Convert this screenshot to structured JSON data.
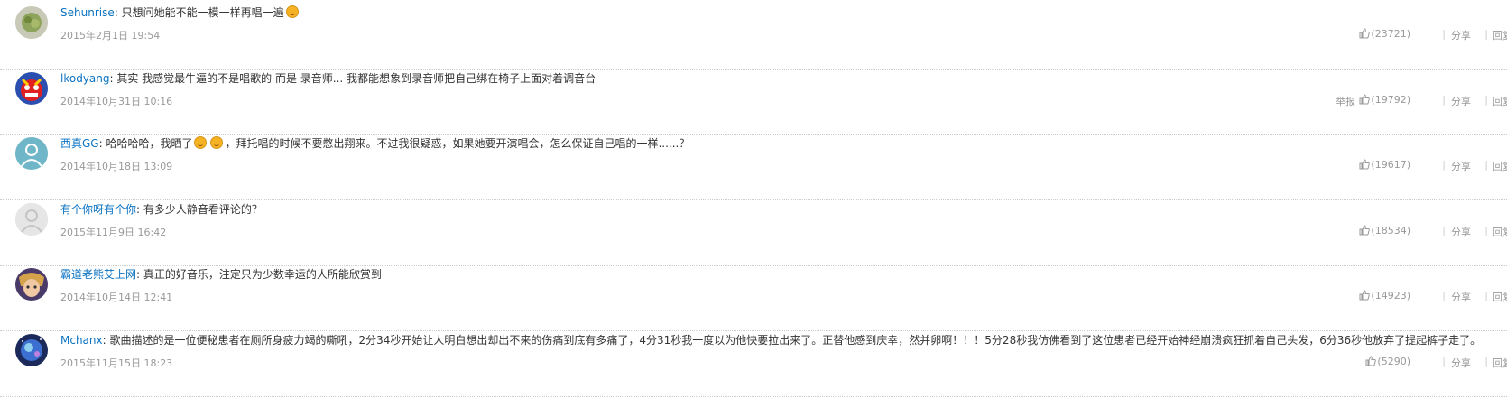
{
  "comments": [
    {
      "user": "Sehunrise",
      "segments": [
        "只想问她能不能一模一样再唱一遍"
      ],
      "emoji_after": [
        true
      ],
      "time": "2015年2月1日 19:54",
      "likes": "(23721)",
      "show_report": false,
      "avatar_icon": "plant-avatar-icon"
    },
    {
      "user": "lkodyang",
      "segments": [
        "其实 我感觉最牛逼的不是唱歌的 而是 录音师... 我都能想象到录音师把自己绑在椅子上面对着调音台"
      ],
      "emoji_after": [
        false
      ],
      "time": "2014年10月31日 10:16",
      "likes": "(19792)",
      "show_report": true,
      "avatar_icon": "red-character-avatar-icon"
    },
    {
      "user": "西真GG",
      "segments": [
        "哈哈哈哈，我晒了",
        "",
        "，拜托唱的时候不要憋出翔来。不过我很疑惑，如果她要开演唱会，怎么保证自己唱的一样......？"
      ],
      "emoji_after": [
        true,
        true,
        false
      ],
      "time": "2014年10月18日 13:09",
      "likes": "(19617)",
      "show_report": false,
      "avatar_icon": "default-teal-avatar-icon"
    },
    {
      "user": "有个你呀有个你",
      "segments": [
        "有多少人静音看评论的？"
      ],
      "emoji_after": [
        false
      ],
      "time": "2015年11月9日 16:42",
      "likes": "(18534)",
      "show_report": false,
      "avatar_icon": "default-gray-avatar-icon"
    },
    {
      "user": "霸道老熊艾上网",
      "segments": [
        "真正的好音乐，注定只为少数幸运的人所能欣赏到"
      ],
      "emoji_after": [
        false
      ],
      "time": "2014年10月14日 12:41",
      "likes": "(14923)",
      "show_report": false,
      "avatar_icon": "anime-character-avatar-icon"
    },
    {
      "user": "Mchanx",
      "segments": [
        "歌曲描述的是一位便秘患者在厕所身疲力竭的嘶吼，2分34秒开始让人明白想出却出不来的伤痛到底有多痛了，4分31秒我一度以为他快要拉出来了。正替他感到庆幸，然并卵啊！！！5分28秒我仿佛看到了这位患者已经开始神经崩溃疯狂抓着自己头发，6分36秒他放弃了提起裤子走了。"
      ],
      "emoji_after": [
        false
      ],
      "time": "2015年11月15日 18:23",
      "likes": "(5290)",
      "show_report": false,
      "avatar_icon": "galaxy-character-avatar-icon"
    }
  ],
  "labels": {
    "report": "举报",
    "share": "分享",
    "reply": "回复",
    "separator": "|",
    "colon": ": "
  },
  "colors": {
    "username": "#0c73c2",
    "text": "#333333",
    "meta": "#999999"
  }
}
